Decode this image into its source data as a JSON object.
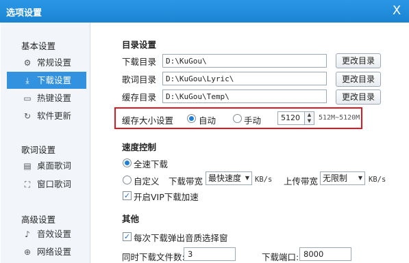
{
  "window": {
    "title": "选项设置",
    "close_glyph": "X"
  },
  "sidebar": {
    "sections": [
      {
        "title": "基本设置",
        "items": [
          {
            "label": "常规设置",
            "icon": "gear-icon",
            "glyph": "⚙",
            "active": false
          },
          {
            "label": "下载设置",
            "icon": "download-icon",
            "glyph": "⤓",
            "active": true
          },
          {
            "label": "热键设置",
            "icon": "keyboard-icon",
            "glyph": "▭",
            "active": false
          },
          {
            "label": "软件更新",
            "icon": "update-icon",
            "glyph": "↻",
            "active": false
          }
        ]
      },
      {
        "title": "歌词设置",
        "items": [
          {
            "label": "桌面歌词",
            "icon": "desktop-lyric-icon",
            "glyph": "▤",
            "active": false
          },
          {
            "label": "窗口歌词",
            "icon": "window-lyric-icon",
            "glyph": "⛶",
            "active": false
          }
        ]
      },
      {
        "title": "高级设置",
        "items": [
          {
            "label": "音效设置",
            "icon": "equalizer-icon",
            "glyph": "♪",
            "active": false
          },
          {
            "label": "网络设置",
            "icon": "network-icon",
            "glyph": "⊕",
            "active": false
          }
        ]
      }
    ]
  },
  "directory": {
    "title": "目录设置",
    "download_label": "下载目录",
    "download_path": "D:\\KuGou\\",
    "lyric_label": "歌词目录",
    "lyric_path": "D:\\KuGou\\Lyric\\",
    "cache_label": "缓存目录",
    "cache_path": "D:\\KuGou\\Temp\\",
    "change_button": "更改目录"
  },
  "cache_size": {
    "label": "缓存大小设置",
    "auto_label": "自动",
    "manual_label": "手动",
    "selected": "自动",
    "value": "5120",
    "range_hint": "512M~5120M"
  },
  "speed": {
    "title": "速度控制",
    "full_speed_label": "全速下载",
    "custom_label": "自定义",
    "selected": "全速下载",
    "download_bw_label": "下载带宽",
    "download_bw_value": "最快速度",
    "upload_bw_label": "上传带宽",
    "upload_bw_value": "无限制",
    "unit": "KB/s",
    "vip_accel_label": "开启VIP下载加速",
    "vip_accel_checked": true
  },
  "other": {
    "title": "其他",
    "quality_popup_label": "每次下载弹出音质选择窗",
    "quality_popup_checked": true,
    "concurrent_label": "同时下载文件数:",
    "concurrent_value": "3",
    "port_label": "下载端口:",
    "port_value": "8000"
  },
  "colors": {
    "accent": "#1f8ad8",
    "highlight_box": "#e0161e",
    "active_nav": "#3392e0"
  }
}
